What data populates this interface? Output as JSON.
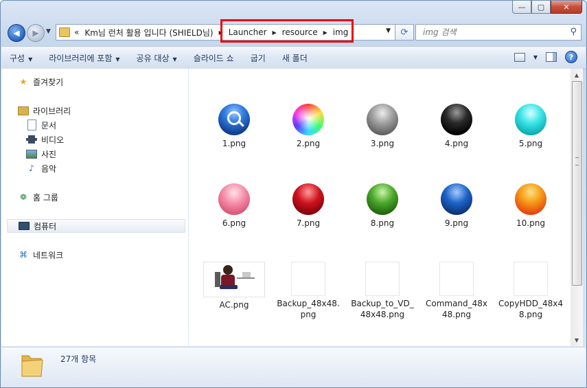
{
  "window": {
    "caption_buttons": {
      "minimize": "—",
      "maximize": "▢",
      "close": "✕"
    }
  },
  "address": {
    "overflow": "«",
    "breadcrumbs": [
      "Km님 런처 활용 입니다 (SHIELD님)",
      "Launcher",
      "resource",
      "img"
    ]
  },
  "search": {
    "placeholder": "img 검색"
  },
  "toolbar": {
    "items": [
      "구성",
      "라이브러리에 포함",
      "공유 대상",
      "슬라이드 쇼",
      "굽기",
      "새 폴더"
    ]
  },
  "nav": {
    "favorites": "즐겨찾기",
    "libraries": "라이브러리",
    "documents": "문서",
    "videos": "비디오",
    "pictures": "사진",
    "music": "음악",
    "homegroup": "홈 그룹",
    "computer": "컴퓨터",
    "network": "네트워크"
  },
  "files": [
    {
      "name": "1.png",
      "kind": "magnifier-orb",
      "color": "#1b5fb8"
    },
    {
      "name": "2.png",
      "kind": "rainbow-orb",
      "color": "#ff66cc"
    },
    {
      "name": "3.png",
      "kind": "orb",
      "color": "#8a8a8a"
    },
    {
      "name": "4.png",
      "kind": "orb",
      "color": "#1a1a1a"
    },
    {
      "name": "5.png",
      "kind": "orb",
      "color": "#19d6d9"
    },
    {
      "name": "6.png",
      "kind": "orb",
      "color": "#f07b98"
    },
    {
      "name": "7.png",
      "kind": "orb",
      "color": "#c0101a"
    },
    {
      "name": "8.png",
      "kind": "orb",
      "color": "#3c9a1e"
    },
    {
      "name": "9.png",
      "kind": "orb",
      "color": "#1556b0"
    },
    {
      "name": "10.png",
      "kind": "orb",
      "color": "#f26a0e"
    },
    {
      "name": "AC.png",
      "kind": "photo",
      "color": "#ffffff"
    },
    {
      "name": "Backup_48x48.png",
      "kind": "blank",
      "color": "#ffffff"
    },
    {
      "name": "Backup_to_VD_48x48.png",
      "kind": "blank",
      "color": "#ffffff"
    },
    {
      "name": "Command_48x48.png",
      "kind": "blank",
      "color": "#ffffff"
    },
    {
      "name": "CopyHDD_48x48.png",
      "kind": "blank",
      "color": "#ffffff"
    }
  ],
  "status": {
    "item_count": "27개 항목"
  },
  "highlight_color": "#ec0000"
}
